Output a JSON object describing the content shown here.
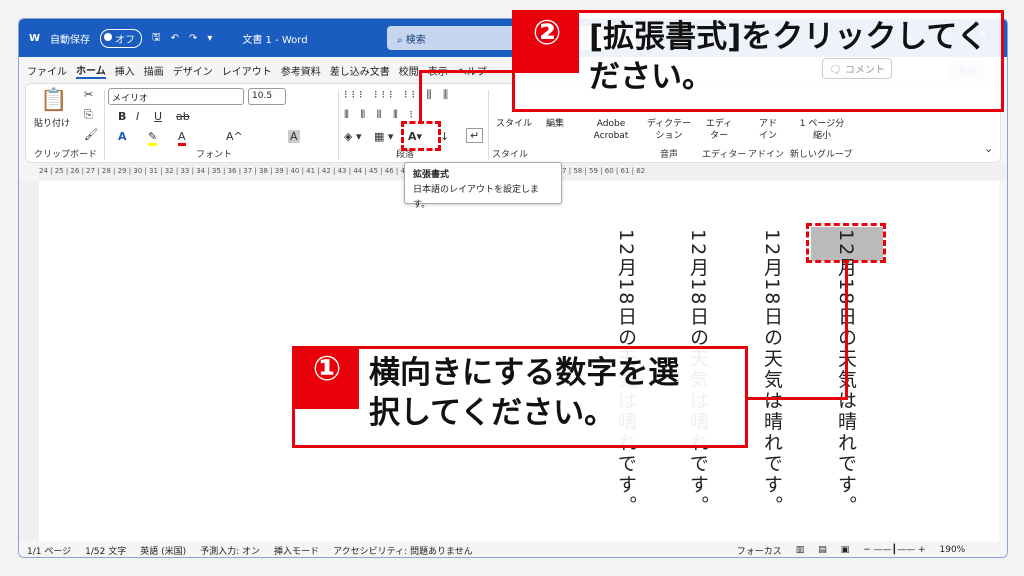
{
  "titlebar": {
    "autosave": "自動保存",
    "toggle": "オフ",
    "doc_title": "文書 1 - Word",
    "search": "検索"
  },
  "menu": [
    "ファイル",
    "ホーム",
    "挿入",
    "描画",
    "デザイン",
    "レイアウト",
    "参考資料",
    "差し込み文書",
    "校閲",
    "表示",
    "ヘルプ"
  ],
  "ribbon": {
    "paste": "貼り付け",
    "clipboard": "クリップボード",
    "font_name": "メイリオ",
    "font_size": "10.5",
    "font": "フォント",
    "paragraph": "段落",
    "style": "スタイル",
    "style_group": "スタイル",
    "edit": "編集",
    "acrobat": "Adobe Acrobat",
    "dictation": "ディクテーション",
    "voice": "音声",
    "editor": "エディター",
    "editor_group": "エディター",
    "addin": "アドイン",
    "addin_group": "アドイン",
    "shrink": "1 ページ分縮小",
    "new_group": "新しいグループ",
    "share": "共有",
    "comment": "コメント",
    "editing": "編集"
  },
  "ruler": "24 | 25 | 26 | 27 | 28 | 29 | 30 | 31 | 32 | 33 | 34 | 35 | 36 | 37 | 38 | 39 | 40 | 41 | 42 | 43 | 44 | 45 | 46 | 47 | 48 | 49 | 50 | 51 | 52 | 53 | 54 | 55 | 56 | 57 | 58 | 59 | 60 | 61 | 62",
  "tooltip": {
    "title": "拡張書式",
    "desc": "日本語のレイアウトを設定します。"
  },
  "document": {
    "lines": [
      "12月18日の天気は晴れです。",
      "12月18日の天気は晴れです。",
      "12月18日の天気は晴れです。",
      "12月18日の天気は晴れです。"
    ]
  },
  "status": {
    "page": "1/1 ページ",
    "words": "1/52 文字",
    "lang": "英語 (米国)",
    "predict": "予測入力: オン",
    "mode": "挿入モード",
    "access": "アクセシビリティ: 問題ありません",
    "focus": "フォーカス",
    "zoom": "190%"
  },
  "callouts": {
    "one": {
      "num": "①",
      "text": "横向きにする数字を選択してください。"
    },
    "two": {
      "num": "②",
      "text": "[拡張書式]をクリックしてください。"
    }
  },
  "colors": {
    "accent": "#1a5cc0",
    "callout": "#e8000b"
  }
}
